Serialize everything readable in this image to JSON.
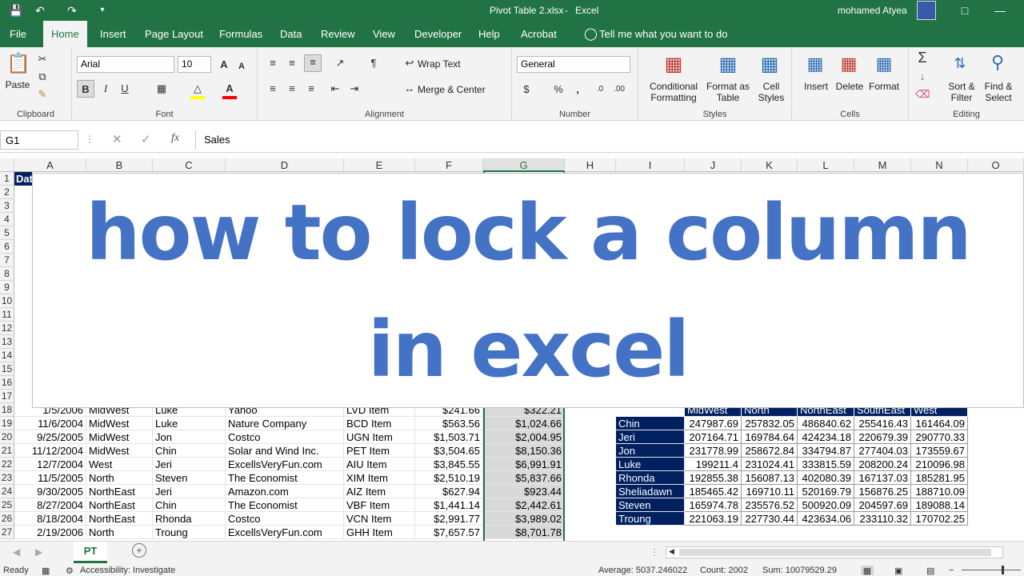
{
  "titlebar": {
    "file": "Pivot Table 2.xlsx",
    "sep": "-",
    "app": "Excel",
    "user": "mohamed Atyea"
  },
  "tabs": [
    "File",
    "Home",
    "Insert",
    "Page Layout",
    "Formulas",
    "Data",
    "Review",
    "View",
    "Developer",
    "Help",
    "Acrobat"
  ],
  "tellme": "Tell me what you want to do",
  "ribbon": {
    "clipboard": {
      "paste": "Paste",
      "label": "Clipboard"
    },
    "font": {
      "name": "Arial",
      "size": "10",
      "label": "Font"
    },
    "alignment": {
      "wrap": "Wrap Text",
      "merge": "Merge & Center",
      "label": "Alignment"
    },
    "number": {
      "format": "General",
      "label": "Number"
    },
    "styles": {
      "cond1": "Conditional",
      "cond2": "Formatting",
      "fmt1": "Format as",
      "fmt2": "Table",
      "cell1": "Cell",
      "cell2": "Styles",
      "label": "Styles"
    },
    "cells": {
      "insert": "Insert",
      "delete": "Delete",
      "format": "Format",
      "label": "Cells"
    },
    "editing": {
      "sort1": "Sort &",
      "sort2": "Filter",
      "find1": "Find &",
      "find2": "Select",
      "label": "Editing"
    }
  },
  "formula": {
    "namebox": "G1",
    "value": "Sales"
  },
  "columns": [
    "A",
    "B",
    "C",
    "D",
    "E",
    "F",
    "G",
    "H",
    "I",
    "J",
    "K",
    "L",
    "M",
    "N",
    "O"
  ],
  "row1_fragment": "Dat",
  "rows_hidden": [
    "1",
    "2",
    "3",
    "4",
    "5",
    "6",
    "7",
    "8",
    "9",
    "10",
    "11",
    "12",
    "13",
    "14",
    "15",
    "16",
    "17"
  ],
  "data_rows": [
    {
      "n": "18",
      "a": "1/5/2006",
      "b": "MidWest",
      "c": "Luke",
      "d": "Yahoo",
      "e": "LVD Item",
      "f": "$241.66",
      "g": "$322.21"
    },
    {
      "n": "19",
      "a": "11/6/2004",
      "b": "MidWest",
      "c": "Luke",
      "d": "Nature Company",
      "e": "BCD Item",
      "f": "$563.56",
      "g": "$1,024.66"
    },
    {
      "n": "20",
      "a": "9/25/2005",
      "b": "MidWest",
      "c": "Jon",
      "d": "Costco",
      "e": "UGN Item",
      "f": "$1,503.71",
      "g": "$2,004.95"
    },
    {
      "n": "21",
      "a": "11/12/2004",
      "b": "MidWest",
      "c": "Chin",
      "d": "Solar and Wind Inc.",
      "e": "PET Item",
      "f": "$3,504.65",
      "g": "$8,150.36"
    },
    {
      "n": "22",
      "a": "12/7/2004",
      "b": "West",
      "c": "Jeri",
      "d": "ExcellsVeryFun.com",
      "e": "AIU Item",
      "f": "$3,845.55",
      "g": "$6,991.91"
    },
    {
      "n": "23",
      "a": "11/5/2005",
      "b": "North",
      "c": "Steven",
      "d": "The Economist",
      "e": "XIM Item",
      "f": "$2,510.19",
      "g": "$5,837.66"
    },
    {
      "n": "24",
      "a": "9/30/2005",
      "b": "NorthEast",
      "c": "Jeri",
      "d": "Amazon.com",
      "e": "AIZ Item",
      "f": "$627.94",
      "g": "$923.44"
    },
    {
      "n": "25",
      "a": "8/27/2004",
      "b": "NorthEast",
      "c": "Chin",
      "d": "The Economist",
      "e": "VBF Item",
      "f": "$1,441.14",
      "g": "$2,442.61"
    },
    {
      "n": "26",
      "a": "8/18/2004",
      "b": "NorthEast",
      "c": "Rhonda",
      "d": "Costco",
      "e": "VCN Item",
      "f": "$2,991.77",
      "g": "$3,989.02"
    },
    {
      "n": "27",
      "a": "2/19/2006",
      "b": "North",
      "c": "Troung",
      "d": "ExcellsVeryFun.com",
      "e": "GHH Item",
      "f": "$7,657.57",
      "g": "$8,701.78"
    }
  ],
  "pivot": {
    "headers": [
      "MidWest",
      "North",
      "NorthEast",
      "SouthEast",
      "West"
    ],
    "rows": [
      {
        "name": "Chin",
        "v": [
          "247987.69",
          "257832.05",
          "486840.62",
          "255416.43",
          "161464.09"
        ]
      },
      {
        "name": "Jeri",
        "v": [
          "207164.71",
          "169784.64",
          "424234.18",
          "220679.39",
          "290770.33"
        ]
      },
      {
        "name": "Jon",
        "v": [
          "231778.99",
          "258672.84",
          "334794.87",
          "277404.03",
          "173559.67"
        ]
      },
      {
        "name": "Luke",
        "v": [
          "199211.4",
          "231024.41",
          "333815.59",
          "208200.24",
          "210096.98"
        ]
      },
      {
        "name": "Rhonda",
        "v": [
          "192855.38",
          "156087.13",
          "402080.39",
          "167137.03",
          "185281.95"
        ]
      },
      {
        "name": "Sheliadawn",
        "v": [
          "185465.42",
          "169710.11",
          "520169.79",
          "156876.25",
          "188710.09"
        ]
      },
      {
        "name": "Steven",
        "v": [
          "165974.78",
          "235576.52",
          "500920.09",
          "204597.69",
          "189088.14"
        ]
      },
      {
        "name": "Troung",
        "v": [
          "221063.19",
          "227730.44",
          "423634.06",
          "233110.32",
          "170702.25"
        ]
      }
    ]
  },
  "overlay": {
    "line1": "how to lock a column",
    "line2": "in excel"
  },
  "sheet_tab": "PT",
  "status": {
    "ready": "Ready",
    "access": "Accessibility: Investigate",
    "average": "Average: 5037.246022",
    "count": "Count: 2002",
    "sum": "Sum: 10079529.29"
  },
  "colors": {
    "excel_green": "#217346",
    "pivot_blue": "#002060",
    "overlay_blue": "#4472c4"
  }
}
